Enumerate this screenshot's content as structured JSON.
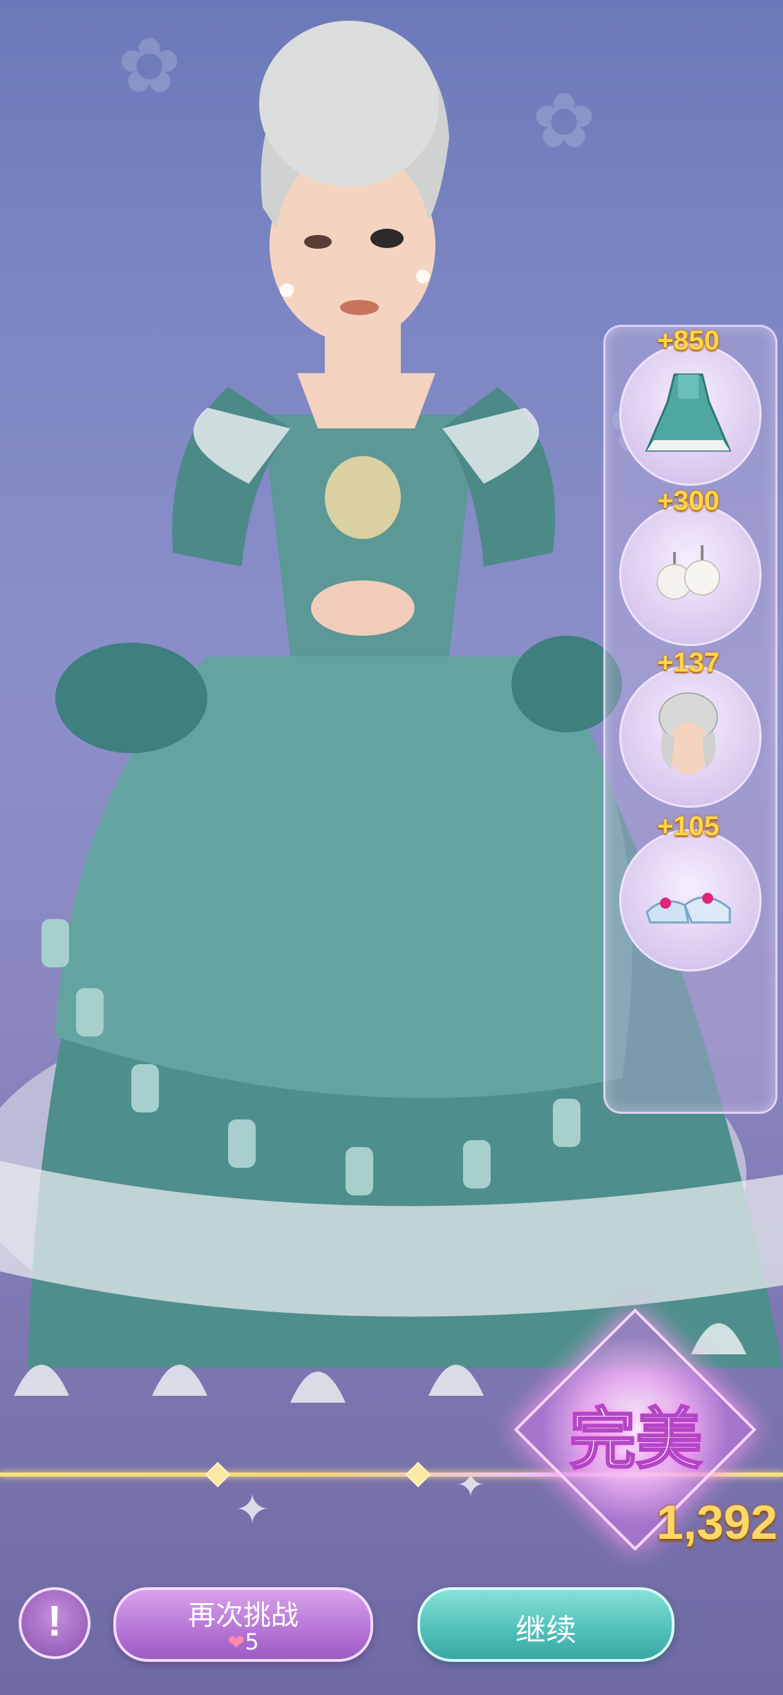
{
  "colors": {
    "score_gold": "#ffd64a",
    "retry_purple": "#b778d6",
    "continue_teal": "#53c2bb",
    "dress_teal": "#4c8f8c"
  },
  "items": [
    {
      "score": "+850",
      "icon": "dress-icon"
    },
    {
      "score": "+300",
      "icon": "pearl-earrings-icon"
    },
    {
      "score": "+137",
      "icon": "hairstyle-icon"
    },
    {
      "score": "+105",
      "icon": "shoes-icon"
    }
  ],
  "result": {
    "rating": "完美",
    "total_score": "1,392"
  },
  "buttons": {
    "info": "!",
    "retry_label": "再次挑战",
    "retry_cost_icon": "heart-icon",
    "retry_cost": "5",
    "continue_label": "继续"
  }
}
